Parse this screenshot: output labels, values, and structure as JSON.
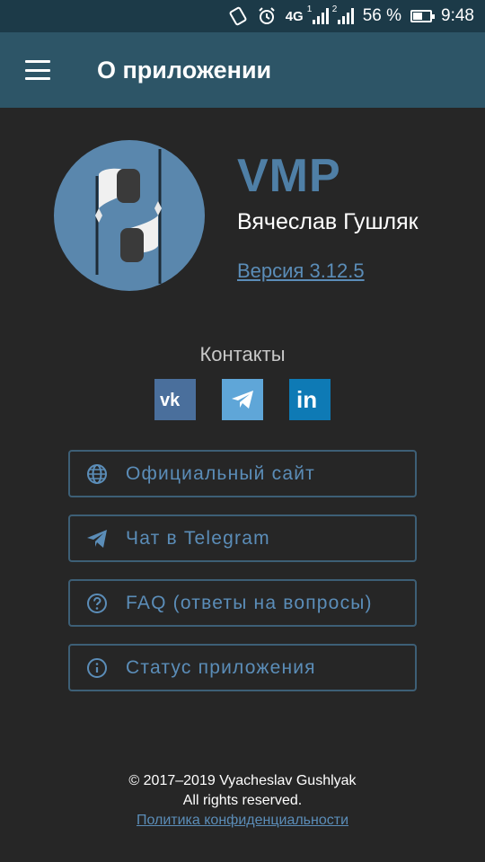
{
  "status_bar": {
    "network_type": "4G",
    "sim1_badge": "1",
    "sim2_badge": "2",
    "battery_percent": "56 %",
    "battery_level": 0.56,
    "time": "9:48"
  },
  "app_bar": {
    "title": "О приложении",
    "menu_icon": "hamburger-menu-icon"
  },
  "about": {
    "app_name": "VMP",
    "author": "Вячеслав Гушляк",
    "version": "Версия 3.12.5"
  },
  "contacts": {
    "title": "Контакты",
    "items": [
      {
        "name": "VK",
        "icon": "vk-icon",
        "color": "#4a6f9c"
      },
      {
        "name": "Telegram",
        "icon": "telegram-icon",
        "color": "#5fa6d8"
      },
      {
        "name": "LinkedIn",
        "icon": "linkedin-icon",
        "color": "#0e7ab5"
      }
    ]
  },
  "links": [
    {
      "label": "Официальный сайт",
      "icon": "globe-icon"
    },
    {
      "label": "Чат в Telegram",
      "icon": "send-icon"
    },
    {
      "label": "FAQ (ответы на вопросы)",
      "icon": "help-circle-icon"
    },
    {
      "label": "Статус приложения",
      "icon": "info-icon"
    }
  ],
  "footer": {
    "copyright": "© 2017–2019 Vyacheslav Gushlyak",
    "rights": "All rights reserved.",
    "privacy_link": "Политика конфиденциальности"
  },
  "colors": {
    "accent": "#5b8db8",
    "app_bar": "#2d5567",
    "status_bar": "#1c3a48",
    "background": "#262626"
  }
}
